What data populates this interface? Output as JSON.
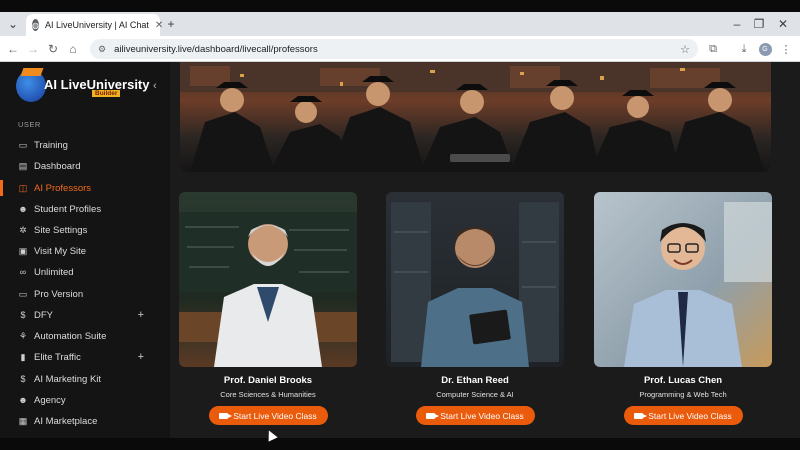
{
  "browser": {
    "tab_title": "AI LiveUniversity | AI Chat",
    "url": "ailiveuniversity.live/dashboard/livecall/professors",
    "profile_initial": "G"
  },
  "sidebar": {
    "brand": "AI LiveUniversity",
    "brand_badge": "Builder",
    "section_label": "USER",
    "items": [
      {
        "label": "Training",
        "icon": "monitor-icon"
      },
      {
        "label": "Dashboard",
        "icon": "dashboard-icon"
      },
      {
        "label": "AI Professors",
        "icon": "professor-icon",
        "active": true
      },
      {
        "label": "Student Profiles",
        "icon": "users-icon"
      },
      {
        "label": "Site Settings",
        "icon": "gear-icon"
      },
      {
        "label": "Visit My Site",
        "icon": "browser-icon"
      },
      {
        "label": "Unlimited",
        "icon": "infinity-icon"
      },
      {
        "label": "Pro Version",
        "icon": "monitor-icon"
      },
      {
        "label": "DFY",
        "icon": "dollar-icon",
        "expandable": true
      },
      {
        "label": "Automation Suite",
        "icon": "magic-icon"
      },
      {
        "label": "Elite Traffic",
        "icon": "traffic-icon",
        "expandable": true
      },
      {
        "label": "AI Marketing Kit",
        "icon": "dollar-icon"
      },
      {
        "label": "Agency",
        "icon": "users-icon"
      },
      {
        "label": "AI Marketplace",
        "icon": "store-icon"
      }
    ]
  },
  "professors": [
    {
      "name": "Prof. Daniel Brooks",
      "subject": "Core Sciences & Humanities",
      "cta": "Start Live Video Class"
    },
    {
      "name": "Dr. Ethan Reed",
      "subject": "Computer Science & AI",
      "cta": "Start Live Video Class"
    },
    {
      "name": "Prof. Lucas Chen",
      "subject": "Programming & Web Tech",
      "cta": "Start Live Video Class"
    }
  ],
  "colors": {
    "accent": "#ea5b0c",
    "sidebar_bg": "#141414",
    "main_bg": "#1b1b1b"
  }
}
